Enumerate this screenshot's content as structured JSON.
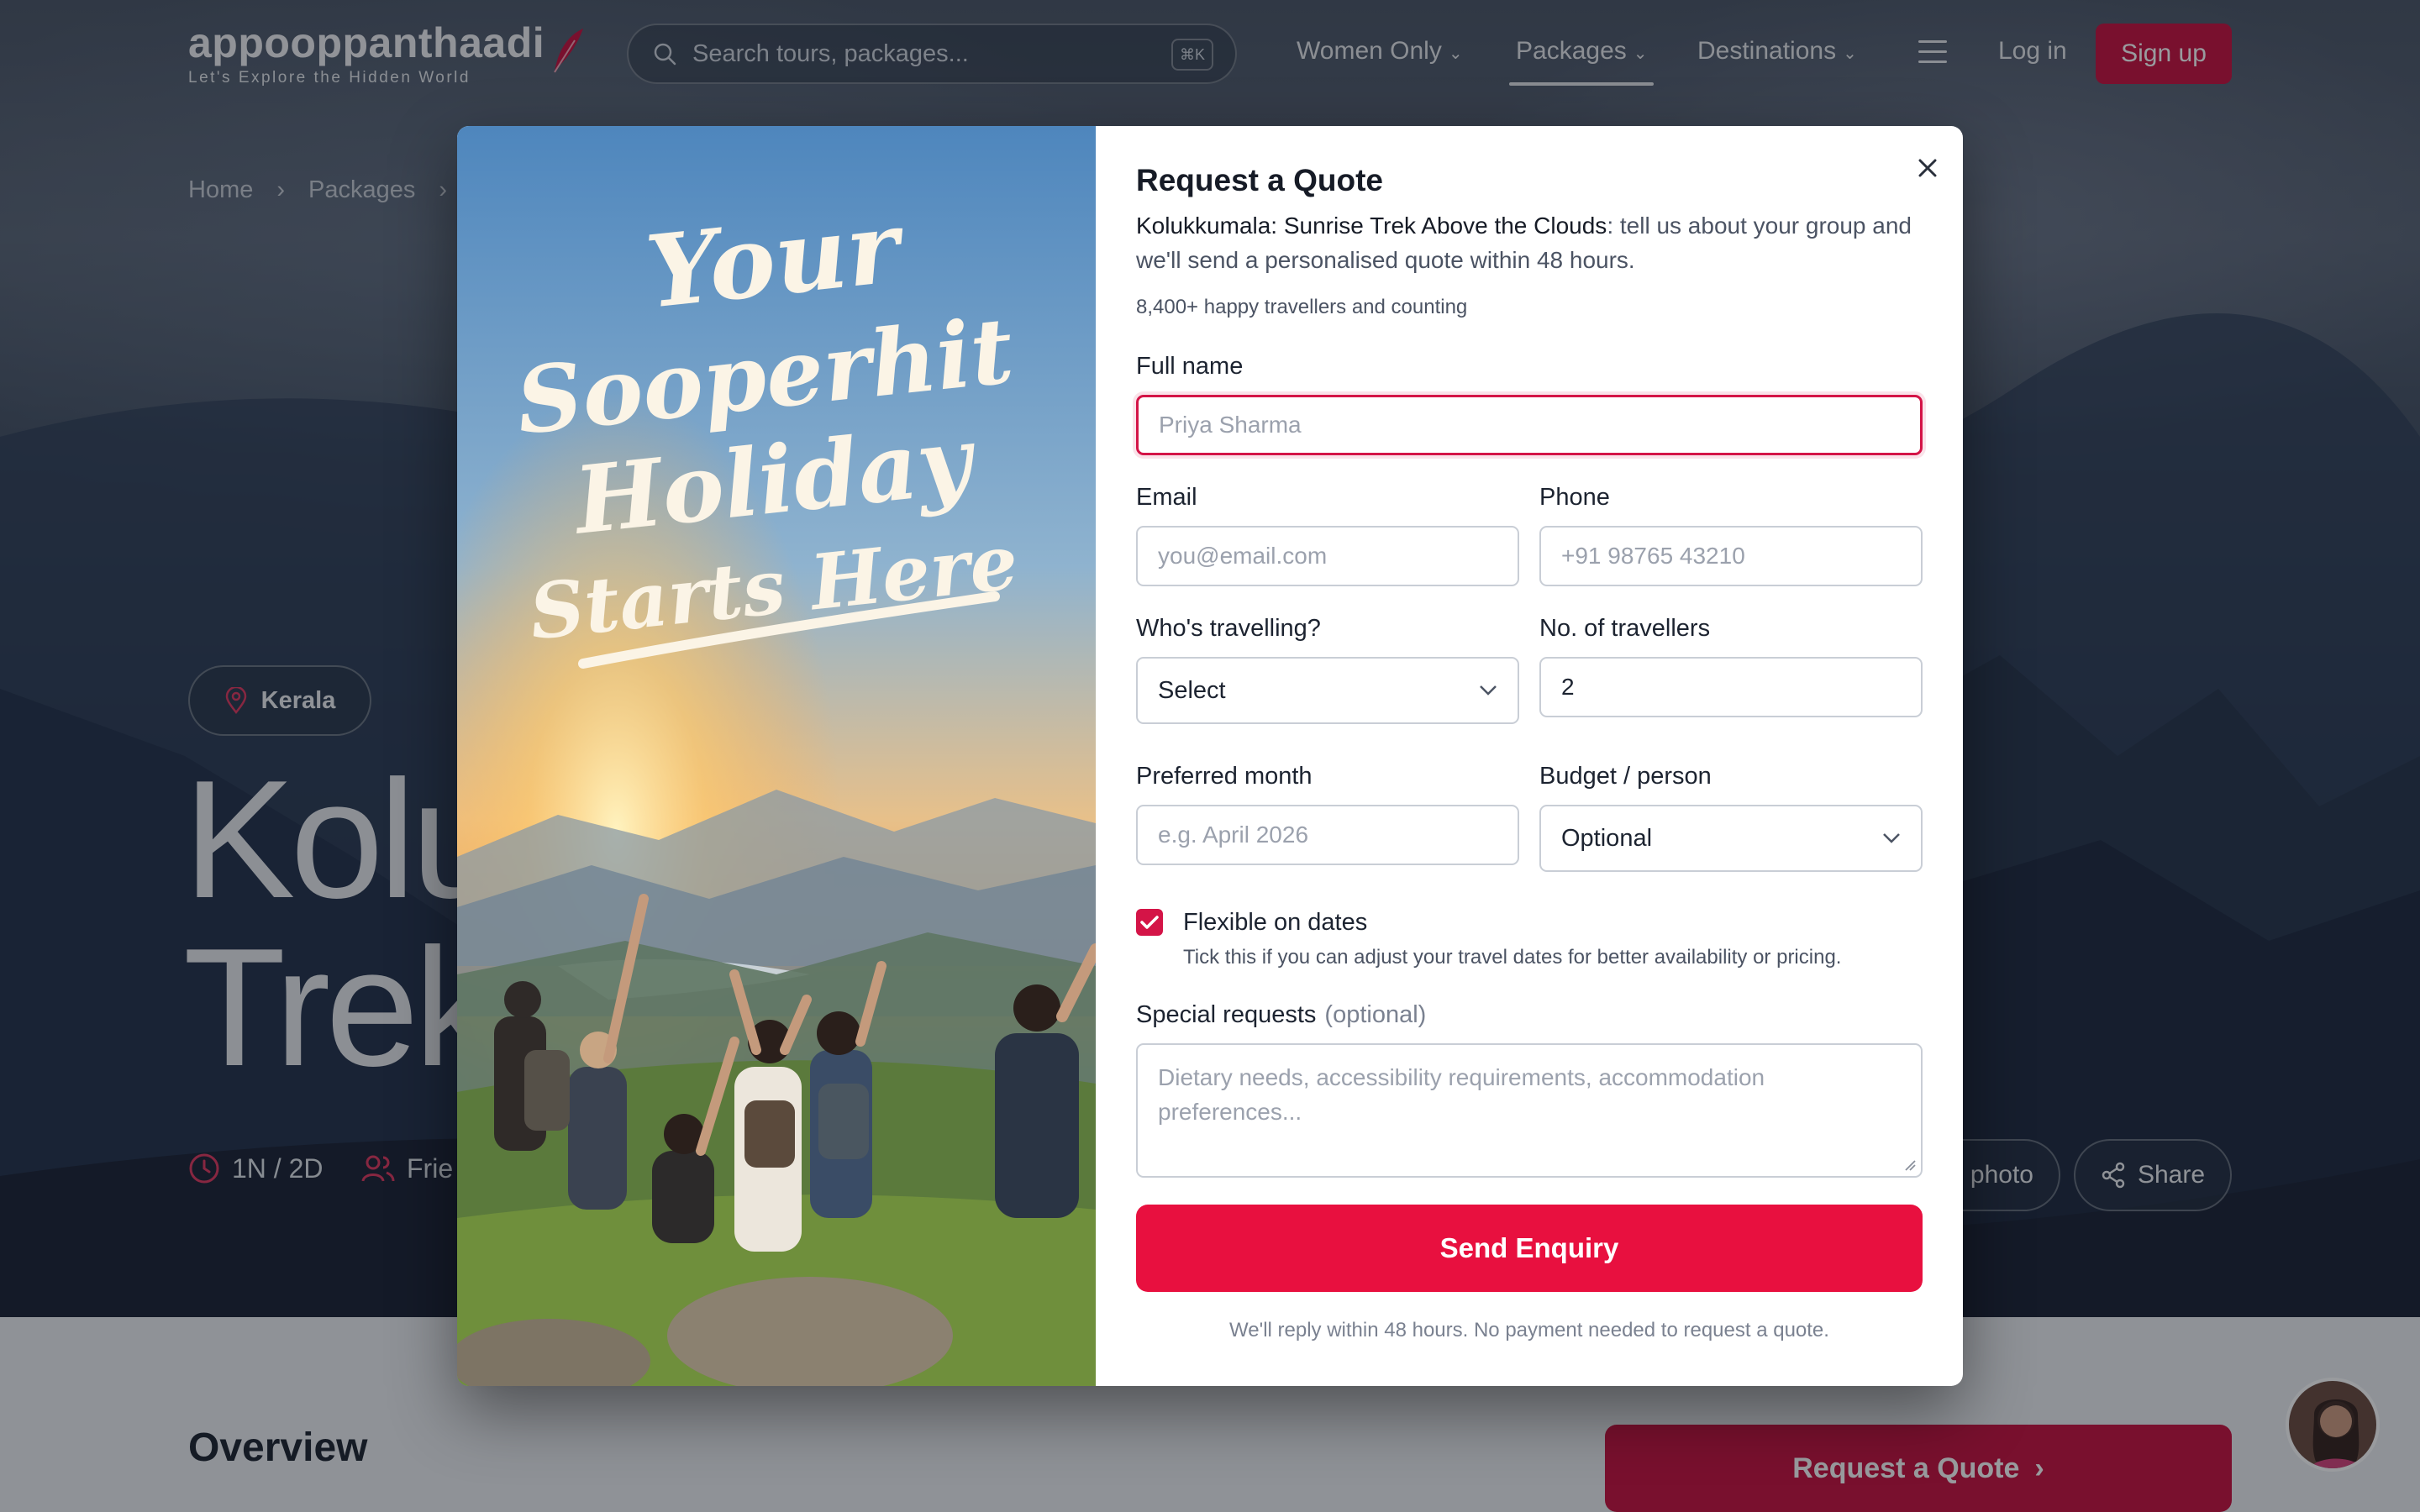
{
  "header": {
    "logo_name": "appooppanthaadi",
    "logo_tagline": "Let's Explore the Hidden World",
    "search_placeholder": "Search tours, packages...",
    "search_shortcut": "⌘K",
    "nav": [
      {
        "label": "Women Only",
        "has_dropdown": true
      },
      {
        "label": "Packages",
        "has_dropdown": true,
        "active": true
      },
      {
        "label": "Destinations",
        "has_dropdown": true
      }
    ],
    "login_label": "Log in",
    "signup_label": "Sign up"
  },
  "breadcrumb": [
    "Home",
    "Packages"
  ],
  "hero": {
    "region": "Kerala",
    "title_line1": "Kolu",
    "title_line2": "Trek",
    "duration": "1N / 2D",
    "group_type": "Frie",
    "photo_button": "photo",
    "share_button": "Share"
  },
  "page": {
    "overview_heading": "Overview",
    "cta_label": "Request a Quote"
  },
  "modal": {
    "poster_text": [
      "Your",
      "Sooperhit",
      "Holiday",
      "Starts Here"
    ],
    "title": "Request a Quote",
    "package_name": "Kolukkumala: Sunrise Trek Above the Clouds",
    "intro_suffix": ": tell us about your group and we'll send a personalised quote within 48 hours.",
    "social_proof": "8,400+ happy travellers and counting",
    "fields": {
      "full_name": {
        "label": "Full name",
        "placeholder": "Priya Sharma"
      },
      "email": {
        "label": "Email",
        "placeholder": "you@email.com"
      },
      "phone": {
        "label": "Phone",
        "placeholder": "+91 98765 43210"
      },
      "who": {
        "label": "Who's travelling?",
        "value": "Select"
      },
      "travellers": {
        "label": "No. of travellers",
        "value": "2"
      },
      "month": {
        "label": "Preferred month",
        "placeholder": "e.g. April 2026"
      },
      "budget": {
        "label": "Budget / person",
        "value": "Optional"
      },
      "flexible": {
        "label": "Flexible on dates",
        "checked": true,
        "help": "Tick this if you can adjust your travel dates for better availability or pricing."
      },
      "requests": {
        "label": "Special requests",
        "optional_tag": "(optional)",
        "placeholder": "Dietary needs, accessibility requirements, accommodation preferences..."
      }
    },
    "submit_label": "Send Enquiry",
    "footer_note": "We'll reply within 48 hours. No payment needed to request a quote."
  },
  "colors": {
    "brand": "#c8103e",
    "accent": "#e8103f",
    "focus_border": "#d41447"
  }
}
